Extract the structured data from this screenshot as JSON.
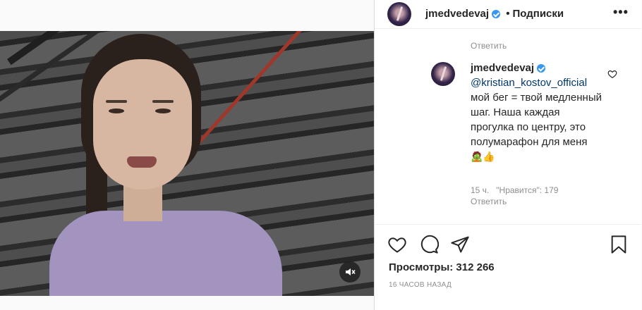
{
  "video": {
    "mute_icon": "speaker-muted-icon"
  },
  "header": {
    "username": "jmedvedevaj",
    "separator": "•",
    "follow_label": "Подписки",
    "more_label": "•••"
  },
  "thread": {
    "reply_top_label": "Ответить"
  },
  "comment": {
    "username": "jmedvedevaj",
    "mention": "@kristian_kostov_official",
    "text": "мой бег = твой медленный шаг. Наша каждая прогулка по центру, это полумарафон для меня",
    "emoji": "🧟👍",
    "age": "15 ч.",
    "likes": "\"Нравится\": 179",
    "reply_label": "Ответить"
  },
  "post": {
    "views": "Просмотры: 312 266",
    "timestamp": "16 ЧАСОВ НАЗАД"
  },
  "colors": {
    "accent": "#3897f0",
    "muted_text": "#8e8e8e",
    "mention": "#00376b"
  }
}
